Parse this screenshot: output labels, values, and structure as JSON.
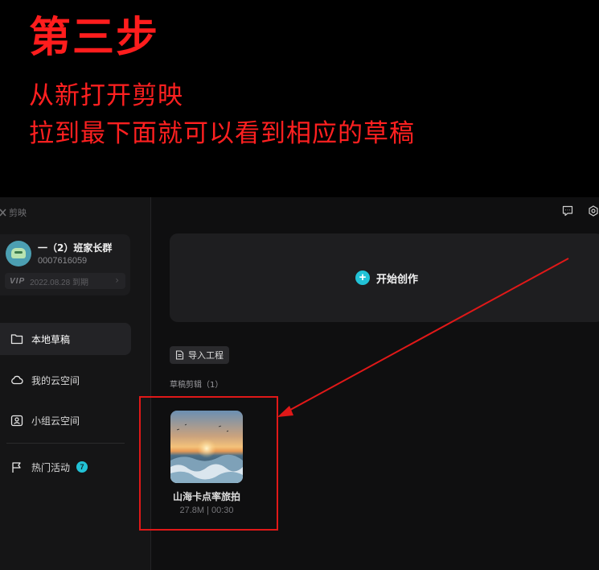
{
  "banner": {
    "title": "第三步",
    "line1": "从新打开剪映",
    "line2": "拉到最下面就可以看到相应的草稿"
  },
  "app": {
    "brand": "剪映",
    "profile": {
      "name": "一（2）班家长群",
      "id": "0007616059",
      "vip_badge": "VIP",
      "vip_expiry": "2022.08.28 到期"
    },
    "nav": [
      {
        "label": "本地草稿",
        "icon": "folder-icon",
        "active": true
      },
      {
        "label": "我的云空间",
        "icon": "cloud-icon",
        "active": false
      },
      {
        "label": "小组云空间",
        "icon": "group-cloud-icon",
        "active": false
      },
      {
        "label": "热门活动",
        "icon": "flag-icon",
        "active": false,
        "badge": "7"
      }
    ],
    "top_icons": [
      "feedback-icon",
      "settings-icon"
    ],
    "create_label": "开始创作",
    "import_label": "导入工程",
    "section_label": "草稿剪辑（1）",
    "drafts": [
      {
        "title": "山海卡点率旅拍",
        "size": "27.8M",
        "duration": "00:30",
        "meta": "27.8M | 00:30"
      }
    ]
  },
  "colors": {
    "annotation_red": "#ff1d1d",
    "accent_cyan": "#22c2d6",
    "background": "#0f0f10"
  }
}
